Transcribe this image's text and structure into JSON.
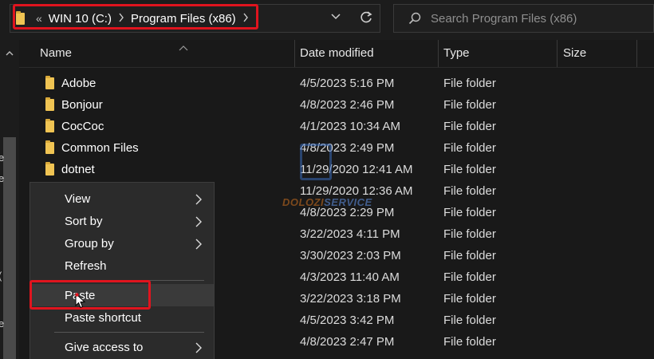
{
  "breadcrumb": {
    "overflow": "«",
    "parts": [
      "WIN 10 (C:)",
      "Program Files (x86)"
    ]
  },
  "search": {
    "placeholder": "Search Program Files (x86)"
  },
  "nav_edge_fragments": [
    "e",
    "e",
    "(",
    "e"
  ],
  "columns": {
    "name": "Name",
    "date": "Date modified",
    "type": "Type",
    "size": "Size"
  },
  "rows": [
    {
      "name": "Adobe",
      "date": "4/5/2023 5:16 PM",
      "type": "File folder"
    },
    {
      "name": "Bonjour",
      "date": "4/8/2023 2:46 PM",
      "type": "File folder"
    },
    {
      "name": "CocCoc",
      "date": "4/1/2023 10:34 AM",
      "type": "File folder"
    },
    {
      "name": "Common Files",
      "date": "4/8/2023 2:49 PM",
      "type": "File folder"
    },
    {
      "name": "dotnet",
      "date": "11/29/2020 12:41 AM",
      "type": "File folder"
    },
    {
      "name": "",
      "date": "11/29/2020 12:36 AM",
      "type": "File folder"
    },
    {
      "name": "",
      "date": "4/8/2023 2:29 PM",
      "type": "File folder"
    },
    {
      "name": "",
      "date": "3/22/2023 4:11 PM",
      "type": "File folder"
    },
    {
      "name": "",
      "date": "3/30/2023 2:03 PM",
      "type": "File folder"
    },
    {
      "name": "",
      "date": "4/3/2023 11:40 AM",
      "type": "File folder"
    },
    {
      "name": "",
      "date": "3/22/2023 3:18 PM",
      "type": "File folder"
    },
    {
      "name": "",
      "date": "4/5/2023 3:42 PM",
      "type": "File folder"
    },
    {
      "name": "",
      "date": "4/8/2023 2:47 PM",
      "type": "File folder"
    }
  ],
  "context_menu": {
    "view": "View",
    "sort_by": "Sort by",
    "group_by": "Group by",
    "refresh": "Refresh",
    "paste": "Paste",
    "paste_shortcut": "Paste shortcut",
    "give_access": "Give access to"
  },
  "watermark": {
    "brand": "DOLOZI",
    "suffix": "SERVICE"
  },
  "colors": {
    "background": "#191919",
    "menu_background": "#2b2b2b",
    "highlight_red": "#e0141e",
    "folder_yellow": "#f0c453",
    "text": "#ffffff"
  }
}
